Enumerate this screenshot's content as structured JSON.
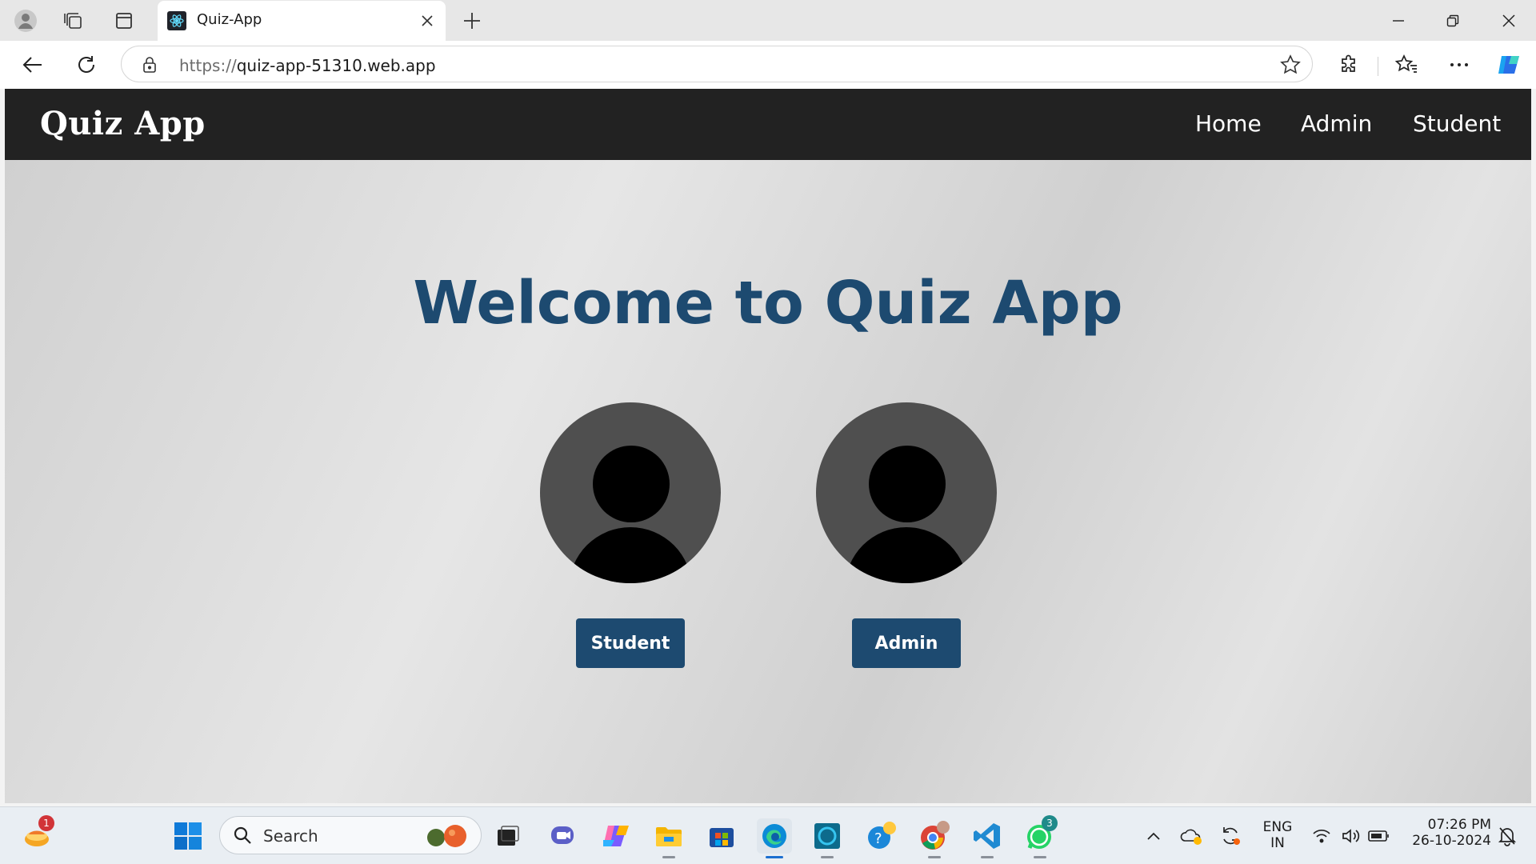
{
  "browser": {
    "tab_title": "Quiz-App",
    "url_protocol": "https://",
    "url_host": "quiz-app-51310.web.app"
  },
  "app": {
    "brand": "Quiz App",
    "nav": [
      "Home",
      "Admin",
      "Student"
    ],
    "headline": "Welcome to Quiz App",
    "student_button": "Student",
    "admin_button": "Admin",
    "colors": {
      "primary": "#1d4a70",
      "navbar": "#222222",
      "avatar_bg": "#4f4f4f"
    }
  },
  "taskbar": {
    "search_placeholder": "Search",
    "widget_badge": "1",
    "whatsapp_badge": "3",
    "lang_line1": "ENG",
    "lang_line2": "IN",
    "time": "07:26 PM",
    "date": "26-10-2024"
  }
}
